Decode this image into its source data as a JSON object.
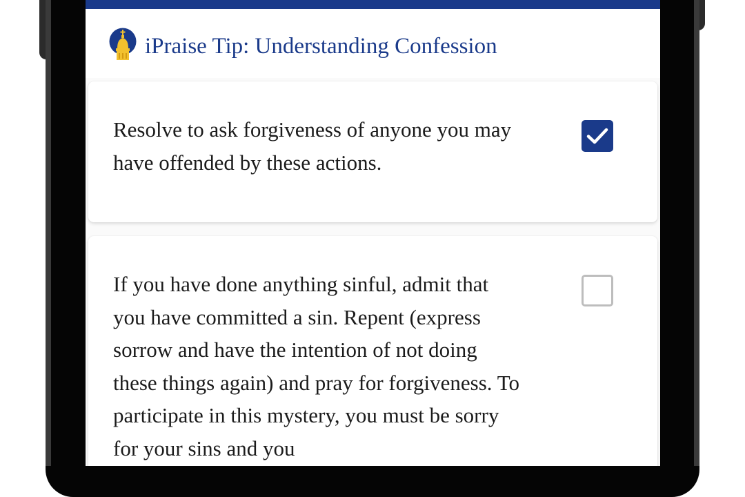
{
  "header": {
    "title": "iPraise Tip: Understanding Confession",
    "logo_icon": "church-dome-icon"
  },
  "colors": {
    "brand": "#1a3a8a",
    "logo_gold": "#f2c12e"
  },
  "items": [
    {
      "text": "Resolve to ask forgiveness of anyone you may have offended by these actions.",
      "checked": true
    },
    {
      "text": "If you have done anything sinful, admit that you have committed a sin. Repent (express sorrow and have the intention of not doing these things again) and pray for forgiveness. To participate in this mystery, you must be sorry for your sins and you",
      "checked": false
    }
  ]
}
